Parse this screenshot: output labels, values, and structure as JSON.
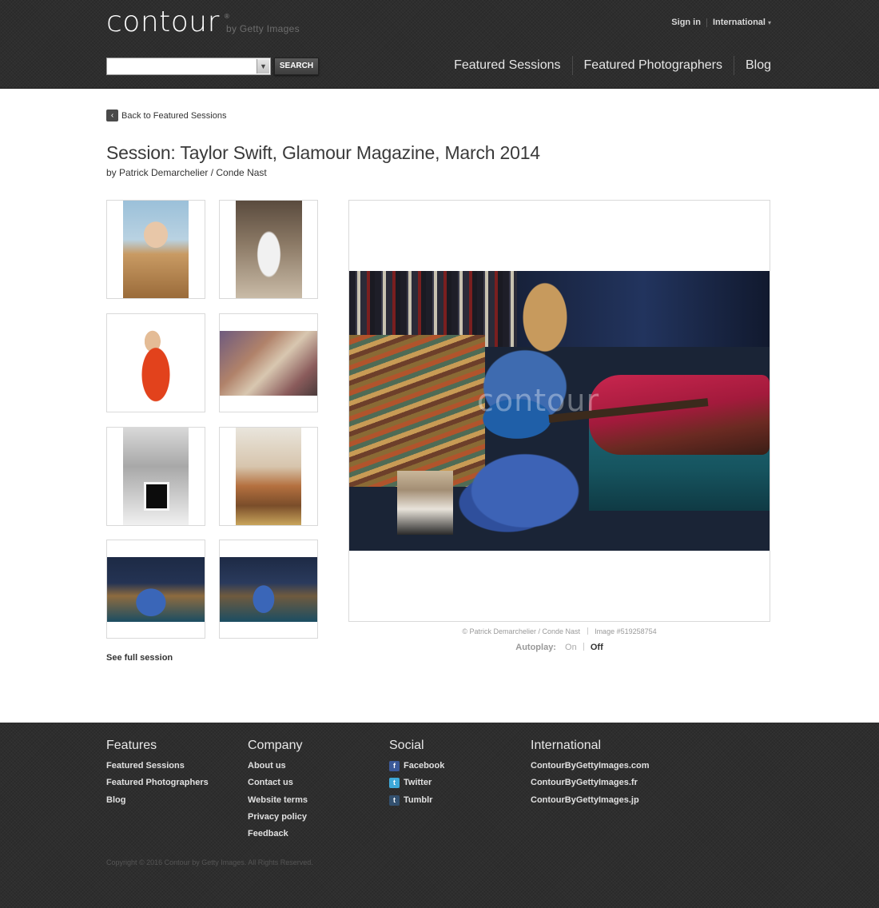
{
  "header": {
    "logo": "contour",
    "logo_reg": "®",
    "logo_by": "by Getty Images",
    "sign_in": "Sign in",
    "international": "International",
    "search_placeholder": "",
    "search_button": "SEARCH",
    "nav": [
      "Featured Sessions",
      "Featured Photographers",
      "Blog"
    ]
  },
  "content": {
    "back_label": "Back to Featured Sessions",
    "title": "Session: Taylor Swift, Glamour Magazine, March 2014",
    "byline": "by Patrick Demarchelier / Conde Nast",
    "see_full": "See full session",
    "watermark": "contour",
    "credit": "© Patrick Demarchelier / Conde Nast",
    "image_id": "Image #519258754",
    "autoplay_label": "Autoplay:",
    "autoplay_on": "On",
    "autoplay_off": "Off"
  },
  "footer": {
    "columns": [
      {
        "title": "Features",
        "links": [
          "Featured Sessions",
          "Featured Photographers",
          "Blog"
        ]
      },
      {
        "title": "Company",
        "links": [
          "About us",
          "Contact us",
          "Website terms",
          "Privacy policy",
          "Feedback"
        ]
      },
      {
        "title": "Social",
        "links": [
          "Facebook",
          "Twitter",
          "Tumblr"
        ]
      },
      {
        "title": "International",
        "links": [
          "ContourByGettyImages.com",
          "ContourByGettyImages.fr",
          "ContourByGettyImages.jp"
        ]
      }
    ],
    "copyright": "Copyright © 2016 Contour by Getty Images. All Rights Reserved."
  },
  "colors": {
    "header_bg": "#2e2e2e",
    "footer_bg": "#2e2e2e",
    "facebook": "#3b5998",
    "twitter": "#3ea9d9",
    "tumblr": "#33506e"
  }
}
